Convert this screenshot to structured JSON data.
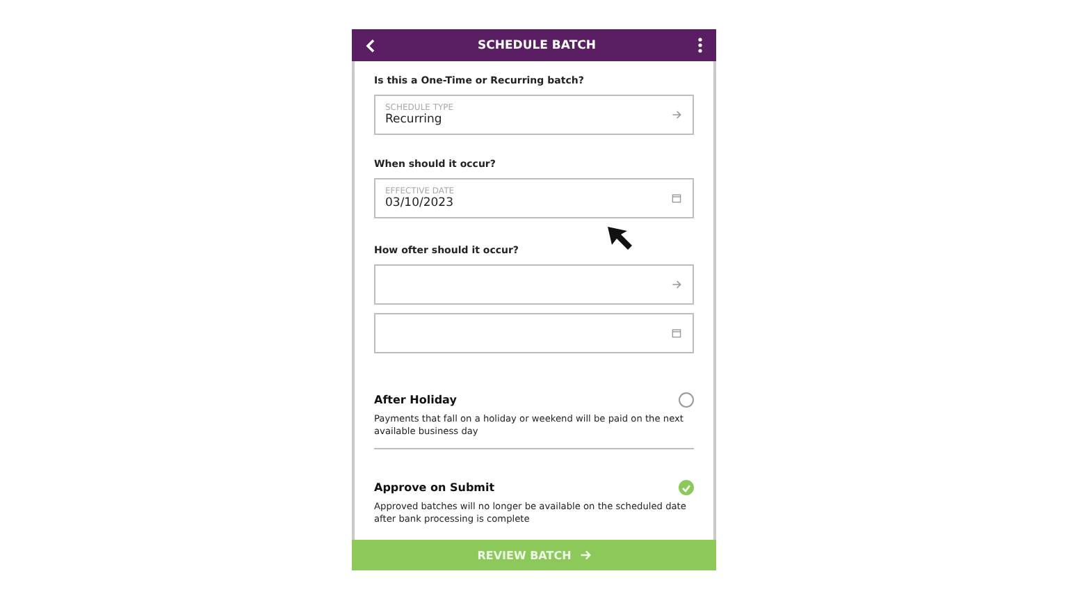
{
  "header": {
    "title": "SCHEDULE BATCH"
  },
  "fields": [
    {
      "question": "Is this a One-Time or Recurring batch?",
      "label": "SCHEDULE TYPE",
      "value": "Recurring",
      "kind": "select"
    },
    {
      "question": "When should it occur?",
      "label": "EFFECTIVE DATE",
      "value": "03/10/2023",
      "kind": "date"
    },
    {
      "question": "How ofter should it occur?",
      "kind": "select"
    },
    {
      "kind": "date"
    }
  ],
  "options": [
    {
      "title": "After Holiday",
      "description": "Payments that fall on a holiday or weekend will be paid on the next available business day",
      "checked": false
    },
    {
      "title": "Approve on Submit",
      "description": "Approved batches will no longer be available on the scheduled date after bank processing is complete",
      "checked": true
    }
  ],
  "footer_button": {
    "label": "REVIEW BATCH"
  }
}
